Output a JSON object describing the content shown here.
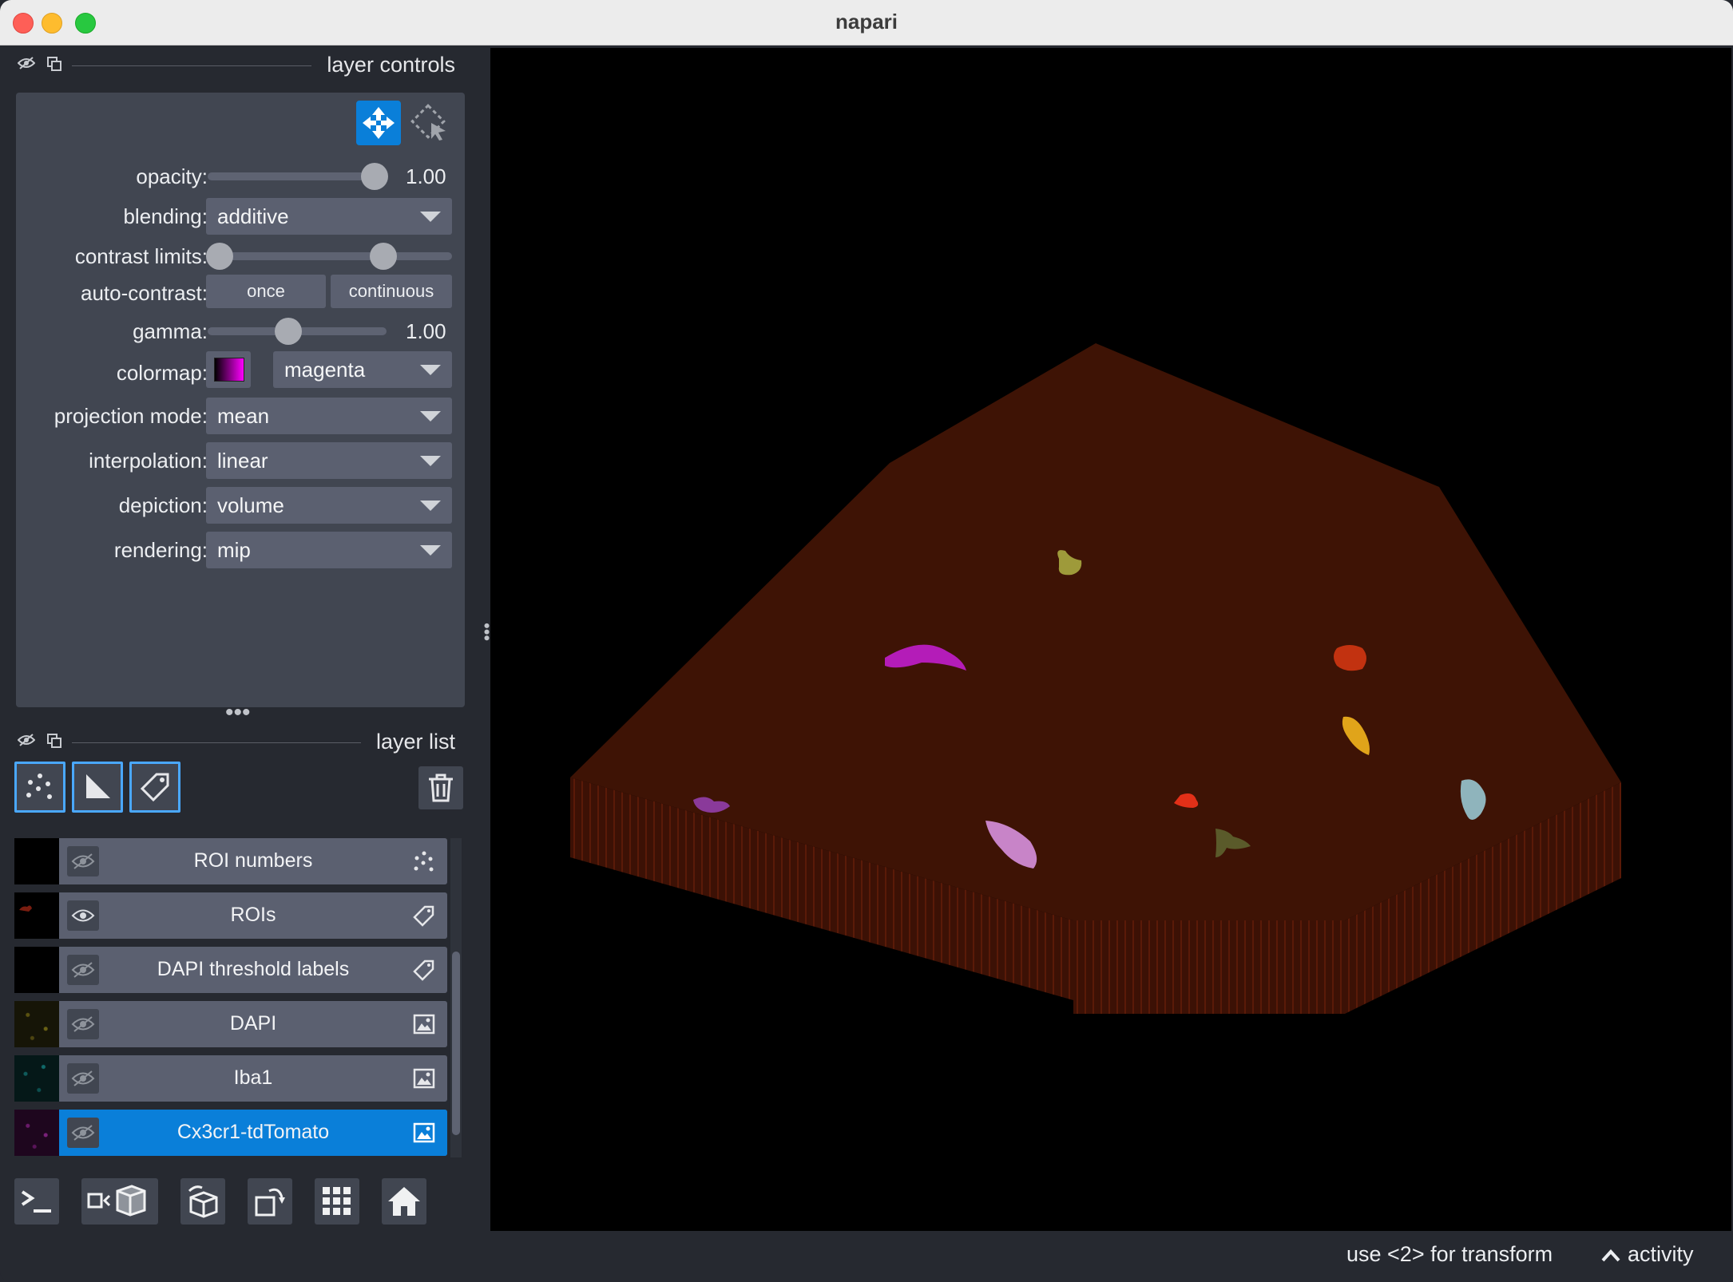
{
  "window": {
    "title": "napari"
  },
  "dock": {
    "controls_title": "layer controls",
    "list_title": "layer list"
  },
  "controls": {
    "opacity_label": "opacity:",
    "opacity_value": "1.00",
    "opacity_fraction": 0.95,
    "blending_label": "blending:",
    "blending_value": "additive",
    "contrast_label": "contrast limits:",
    "contrast_low_fraction": 0.05,
    "contrast_high_fraction": 0.72,
    "autocontrast_label": "auto-contrast:",
    "once_label": "once",
    "continuous_label": "continuous",
    "gamma_label": "gamma:",
    "gamma_value": "1.00",
    "gamma_fraction": 0.45,
    "colormap_label": "colormap:",
    "colormap_value": "magenta",
    "projection_label": "projection mode:",
    "projection_value": "mean",
    "interpolation_label": "interpolation:",
    "interpolation_value": "linear",
    "depiction_label": "depiction:",
    "depiction_value": "volume",
    "rendering_label": "rendering:",
    "rendering_value": "mip"
  },
  "layers": [
    {
      "name": "ROI numbers",
      "type": "points",
      "visible": false,
      "selected": false
    },
    {
      "name": "ROIs",
      "type": "labels",
      "visible": true,
      "selected": false
    },
    {
      "name": "DAPI threshold labels",
      "type": "labels",
      "visible": false,
      "selected": false
    },
    {
      "name": "DAPI",
      "type": "image",
      "visible": false,
      "selected": false
    },
    {
      "name": "Iba1",
      "type": "image",
      "visible": false,
      "selected": false
    },
    {
      "name": "Cx3cr1-tdTomato",
      "type": "image",
      "visible": false,
      "selected": true
    }
  ],
  "status": {
    "hint": "use <2> for transform",
    "activity": "activity"
  },
  "colors": {
    "accent": "#0a7fd9",
    "volume": "#3e1305",
    "panel": "#414651"
  }
}
